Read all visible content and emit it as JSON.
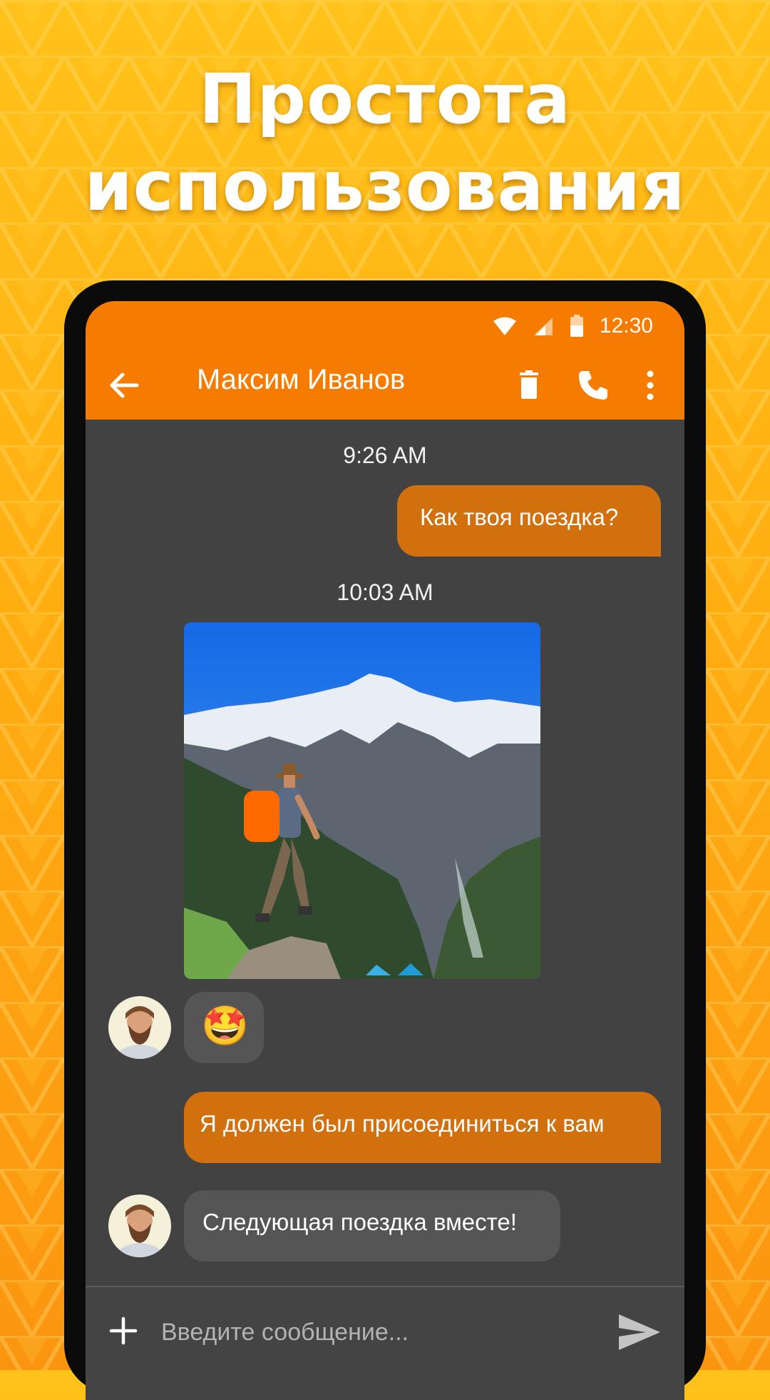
{
  "headline": {
    "line1": "Простота",
    "line2": "использования"
  },
  "status_bar": {
    "time": "12:30",
    "icons": [
      "wifi-icon",
      "cell-signal-icon",
      "battery-icon"
    ]
  },
  "toolbar": {
    "title": "Максим Иванов",
    "icons": [
      "back-arrow-icon",
      "trash-icon",
      "phone-icon",
      "more-vert-icon"
    ]
  },
  "conversation": {
    "timestamp_1": "9:26 AM",
    "message_1": "Как твоя поездка?",
    "timestamp_2": "10:03 AM",
    "photo_alt": "Hiker with orange backpack standing on a rock facing snowy mountains",
    "message_emoji": "🤩",
    "message_2": "Я должен был присоединиться к вам",
    "message_3": "Следующая поездка вместе!"
  },
  "composer": {
    "placeholder": "Введите сообщение...",
    "icons": [
      "plus-icon",
      "send-icon"
    ]
  },
  "colors": {
    "accent": "#f57c00",
    "outgoing_bubble": "#d2700e",
    "incoming_bubble": "#555555",
    "chat_background": "#424242",
    "promo_background": "#ffb414"
  }
}
